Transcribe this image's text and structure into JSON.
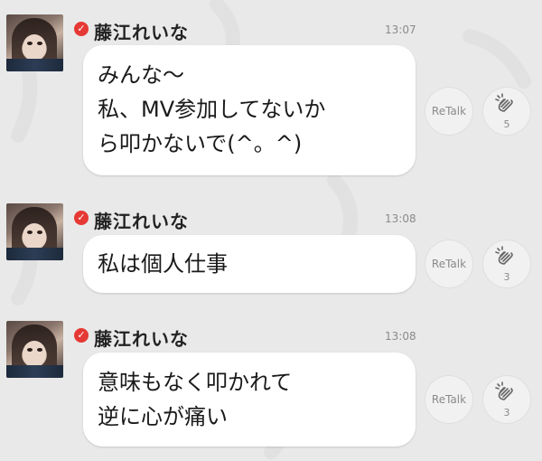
{
  "colors": {
    "background": "#e9e9e9",
    "verified_badge": "#e53935",
    "bubble": "#ffffff"
  },
  "messages": [
    {
      "author": "藤江れいな",
      "time": "13:07",
      "text": "みんな〜\n私、MV参加してないか\nら叩かないで(^。^)",
      "retalk_label": "ReTalk",
      "clap_count": "5",
      "verified_icon": "check-icon"
    },
    {
      "author": "藤江れいな",
      "time": "13:08",
      "text": "私は個人仕事",
      "retalk_label": "ReTalk",
      "clap_count": "3",
      "verified_icon": "check-icon"
    },
    {
      "author": "藤江れいな",
      "time": "13:08",
      "text": "意味もなく叩かれて\n逆に心が痛い",
      "retalk_label": "ReTalk",
      "clap_count": "3",
      "verified_icon": "check-icon"
    }
  ]
}
